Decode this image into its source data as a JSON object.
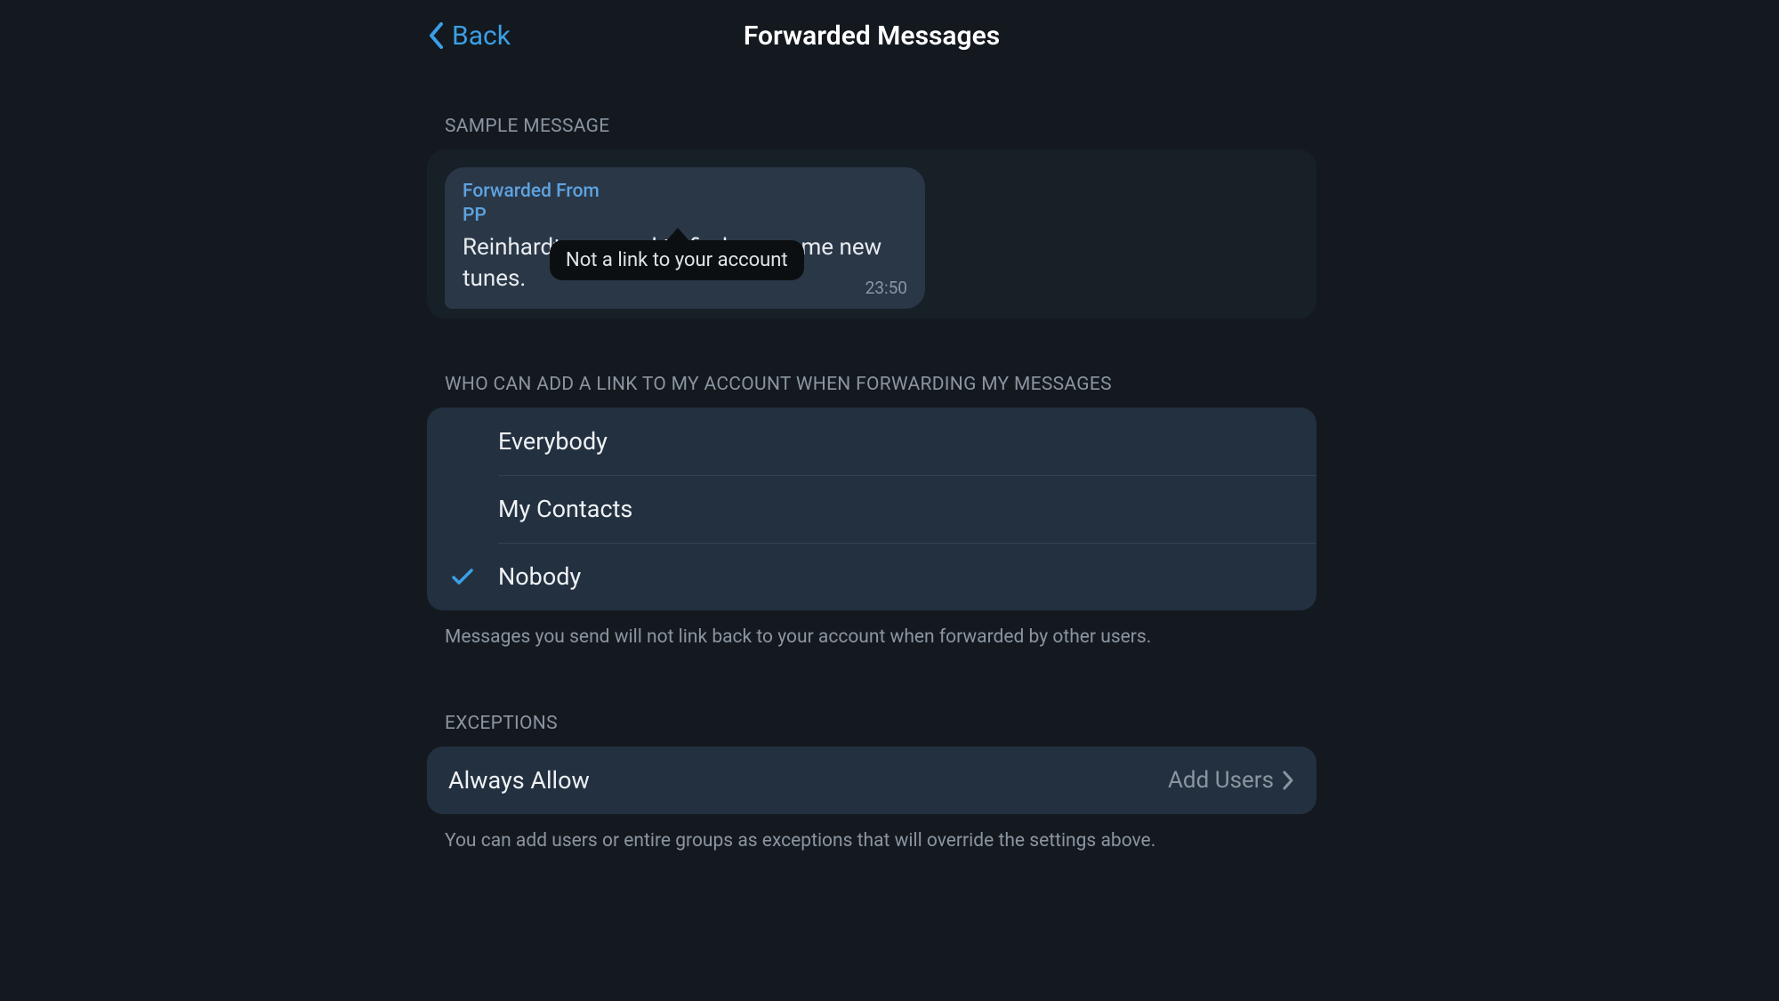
{
  "header": {
    "back_label": "Back",
    "title": "Forwarded Messages"
  },
  "sample": {
    "section_header": "SAMPLE MESSAGE",
    "forwarded_from_label": "Forwarded From",
    "forwarded_from_name": "PP",
    "message_text": "Reinhardt, we need to find you some new tunes.",
    "time": "23:50",
    "tooltip": "Not a link to your account"
  },
  "who": {
    "section_header": "WHO CAN ADD A LINK TO MY ACCOUNT WHEN FORWARDING MY MESSAGES",
    "options": {
      "everybody": "Everybody",
      "my_contacts": "My Contacts",
      "nobody": "Nobody"
    },
    "selected": "nobody",
    "footer": "Messages you send will not link back to your account when forwarded by other users."
  },
  "exceptions": {
    "section_header": "EXCEPTIONS",
    "always_allow_label": "Always Allow",
    "always_allow_value": "Add Users",
    "footer": "You can add users or entire groups as exceptions that will override the settings above."
  },
  "colors": {
    "accent": "#3b9fe6",
    "bg": "#13191f",
    "group_bg": "#233040"
  }
}
